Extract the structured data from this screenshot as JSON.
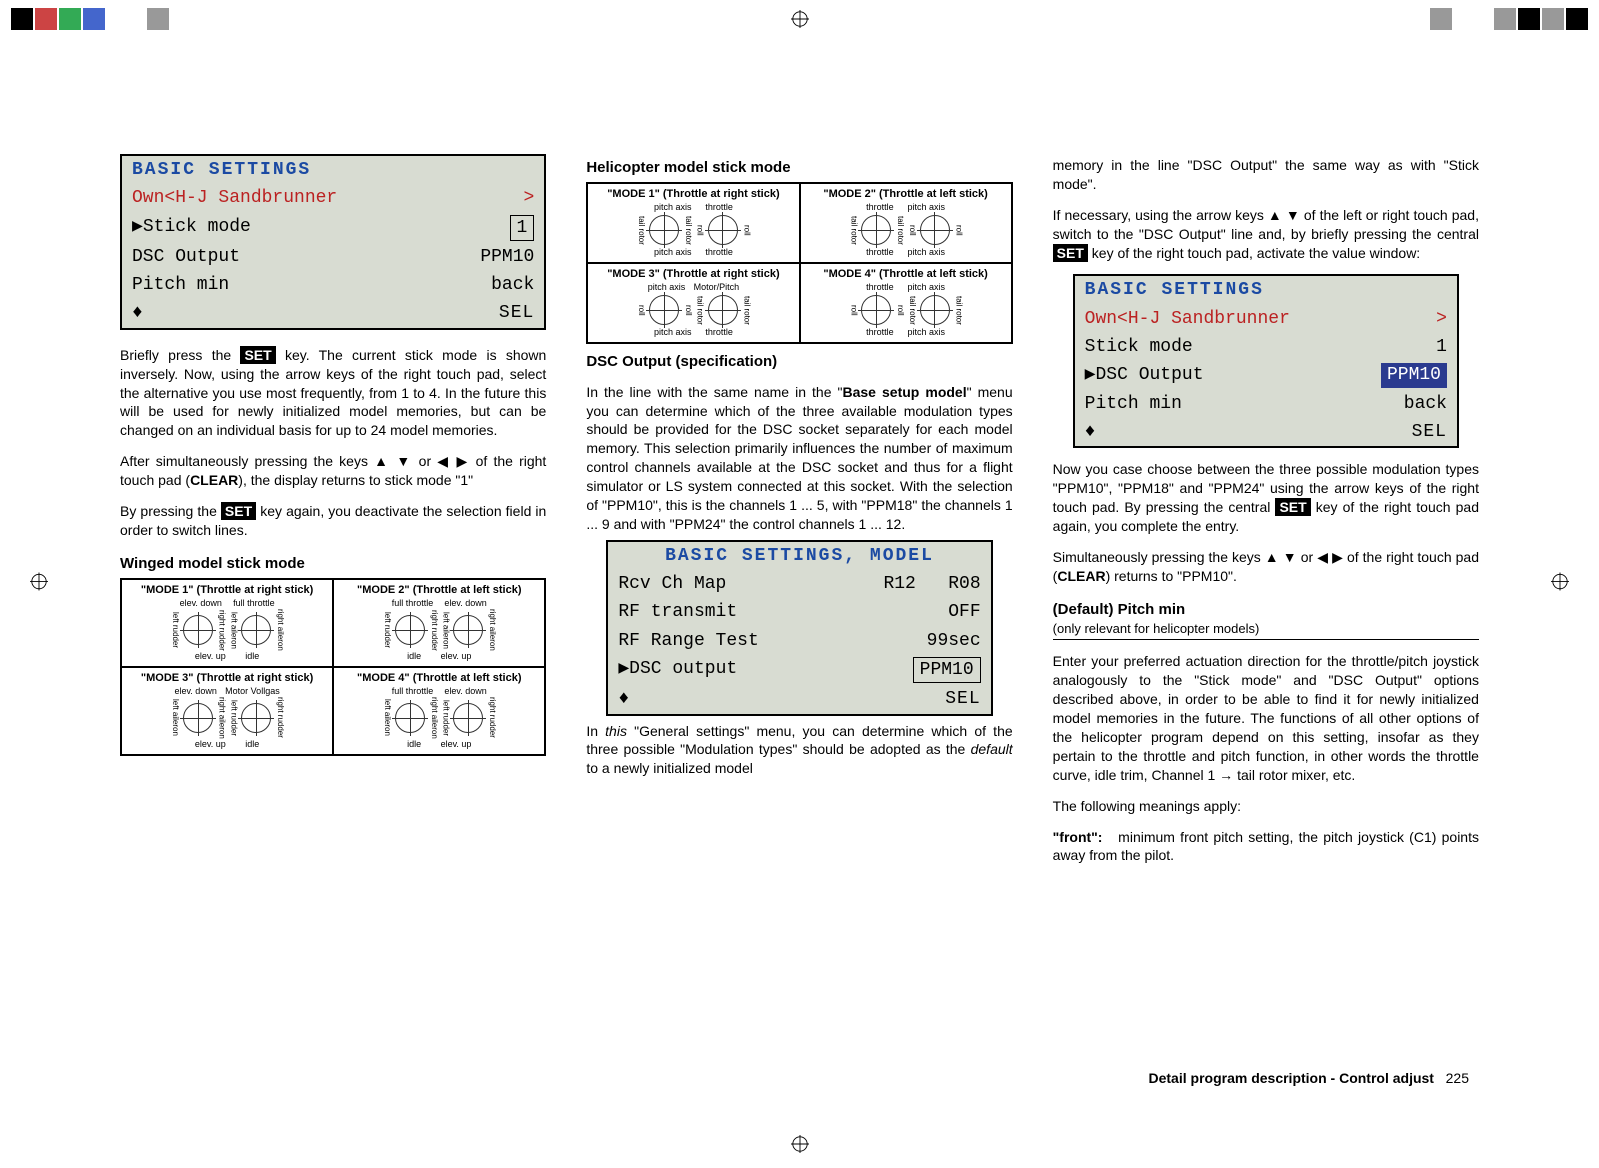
{
  "col1": {
    "lcd1": {
      "title": "BASIC  SETTINGS",
      "owner": "Own<H-J Sandbrunner",
      "owner_arrow": ">",
      "r1l": "▶Stick mode",
      "r1r": "1",
      "r2l": "DSC Output",
      "r2r": "PPM10",
      "r3l": "Pitch min",
      "r3r": "back",
      "r4l": "♦",
      "r4r": "SEL"
    },
    "p1": "Briefly press the ",
    "set": "SET",
    "p1b": " key. The current stick mode is shown inversely. Now, using the arrow keys of the right touch pad, select the alternative you use most frequently, from 1 to 4. In the future this will be used for newly initialized model memories, but can be changed on an individual basis for up to 24 model memories.",
    "p2a": "After simultaneously pressing the keys ▲ ▼ or ◀ ▶ of the right touch pad (",
    "p2b": "CLEAR",
    "p2c": "), the display returns to stick mode \"1\"",
    "p3a": "By pressing the ",
    "p3b": " key again, you deactivate the selection field in order to switch lines.",
    "h1": "Winged model stick mode",
    "diag": {
      "m1": "\"MODE 1\" (Throttle at right stick)",
      "m2": "\"MODE 2\" (Throttle at left stick)",
      "m3": "\"MODE 3\" (Throttle at right stick)",
      "m4": "\"MODE 4\" (Throttle at left stick)",
      "elev_down": "elev. down",
      "elev_up": "elev. up",
      "full_throttle": "full throttle",
      "idle": "idle",
      "motor_vollgas": "Motor Vollgas",
      "left_rudder": "left rudder",
      "right_rudder": "right rudder",
      "left_aileron": "left aileron",
      "right_aileron": "right aileron"
    }
  },
  "col2": {
    "h1": "Helicopter model stick mode",
    "diag": {
      "m1": "\"MODE 1\" (Throttle at right stick)",
      "m2": "\"MODE 2\" (Throttle at left stick)",
      "m3": "\"MODE 3\" (Throttle at right stick)",
      "m4": "\"MODE 4\" (Throttle at left stick)",
      "pitch_axis": "pitch axis",
      "throttle": "throttle",
      "motor_pitch": "Motor/Pitch",
      "tail_rotor": "tail rotor",
      "roll": "roll"
    },
    "h2": "DSC Output (specification)",
    "p1a": "In the line with the same name in the \"",
    "p1b": "Base setup model",
    "p1c": "\" menu you can determine which of the three available modulation types should be provided for the DSC socket separately for each model memory. This selection primarily influences the number of maximum control channels available at the DSC socket and thus for a flight simulator or LS system connected at this socket. With the selection of \"PPM10\", this is the channels 1 ... 5, with \"PPM18\" the channels 1 ... 9 and with \"PPM24\" the control channels 1 ... 12.",
    "lcd": {
      "title": "BASIC  SETTINGS,  MODEL",
      "r1l": "Rcv Ch Map",
      "r1m": "R12",
      "r1r": "R08",
      "r2l": "RF transmit",
      "r2r": "OFF",
      "r3l": "RF Range Test",
      "r3r": "99sec",
      "r4l": "▶DSC output",
      "r4r": "PPM10",
      "r5l": "♦",
      "r5r": "SEL"
    },
    "p2a": "In ",
    "p2b": "this",
    "p2c": " \"General settings\" menu, you can determine which of the three possible \"Modulation types\" should be adopted as the ",
    "p2d": "default",
    "p2e": " to a newly initialized model"
  },
  "col3": {
    "p1": "memory in the line \"DSC Output\" the same way as with \"Stick mode\".",
    "p2a": "If necessary, using the arrow keys ▲ ▼ of the left or right touch pad, switch to the \"DSC Output\" line and, by briefly pressing the central ",
    "p2b": " key of the right touch pad, activate the value window:",
    "lcd": {
      "title": "BASIC  SETTINGS",
      "owner": "Own<H-J Sandbrunner",
      "owner_arrow": ">",
      "r1l": "Stick mode",
      "r1r": "1",
      "r2l": "▶DSC Output",
      "r2r": "PPM10",
      "r3l": "Pitch min",
      "r3r": "back",
      "r4l": "♦",
      "r4r": "SEL"
    },
    "p3a": "Now you case choose between the three possible modulation types \"PPM10\", \"PPM18\" and \"PPM24\" using the arrow keys of the right touch pad. By pressing the central ",
    "p3b": " key of the right touch pad again, you complete the entry.",
    "p4a": "Simultaneously pressing the keys ▲ ▼ or ◀ ▶ of the right touch pad (",
    "p4b": "CLEAR",
    "p4c": ") returns to \"PPM10\".",
    "h1": "(Default) Pitch min",
    "sub1": " (only relevant for helicopter models)",
    "p5": "Enter your preferred actuation direction for the throttle/pitch joystick analogously to the \"Stick mode\" and \"DSC Output\" options described above, in order to be able to find it for newly initialized model memories in the future. The functions of all other options of the helicopter program depend on this setting, insofar as they pertain to the throttle and pitch function, in other words  the throttle curve, idle trim, Channel 1 → tail rotor mixer, etc.",
    "p6": "The following meanings apply:",
    "p7a": "\"front\":",
    "p7b": "minimum front pitch setting, the pitch joystick (C1) points away from the pilot."
  },
  "footer": {
    "text": "Detail program description - Control adjust",
    "page": "225"
  }
}
